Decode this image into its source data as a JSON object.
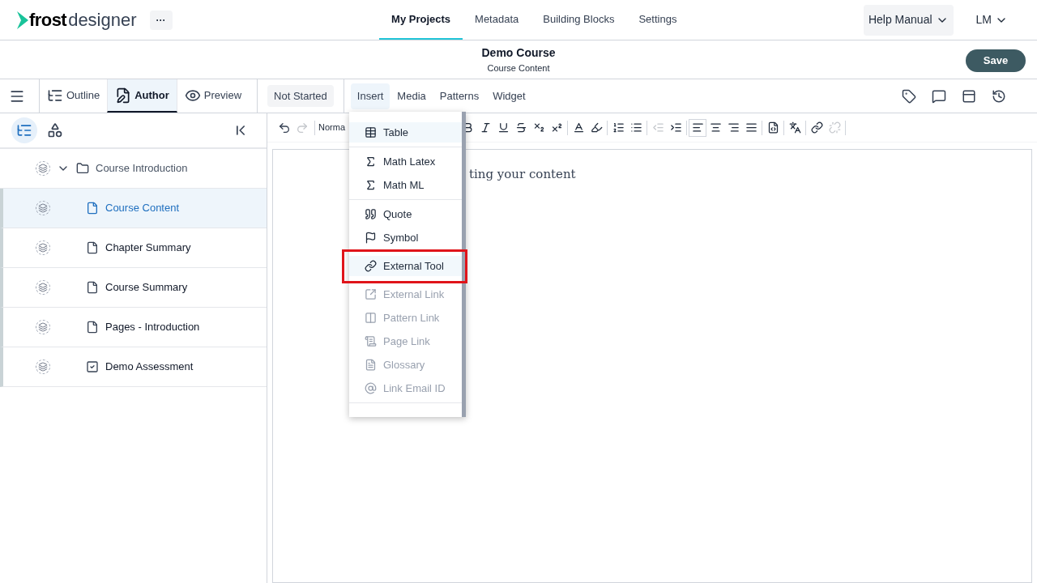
{
  "logo": {
    "part_1": "frost",
    "part_2": "designer"
  },
  "more_button": "···",
  "nav": [
    {
      "label": "My Projects",
      "selected": true
    },
    {
      "label": "Metadata",
      "selected": false
    },
    {
      "label": "Building Blocks",
      "selected": false
    },
    {
      "label": "Settings",
      "selected": false
    }
  ],
  "help_menu": "Help Manual",
  "user_menu": "LM",
  "header": {
    "title": "Demo Course",
    "subtitle": "Course Content",
    "save": "Save"
  },
  "modes": [
    {
      "kind": "outline",
      "label": "Outline",
      "selected": false
    },
    {
      "kind": "author",
      "label": "Author",
      "selected": true
    },
    {
      "kind": "preview",
      "label": "Preview",
      "selected": false
    }
  ],
  "status": "Not Started",
  "insert_tabs": [
    {
      "label": "Insert",
      "selected": true
    },
    {
      "label": "Media",
      "selected": false
    },
    {
      "label": "Patterns",
      "selected": false
    },
    {
      "label": "Widget",
      "selected": false
    }
  ],
  "right_tools": [
    {
      "kind": "tag"
    },
    {
      "kind": "comment"
    },
    {
      "kind": "panel"
    },
    {
      "kind": "history"
    }
  ],
  "sidebar": {
    "views": [
      {
        "kind": "tree",
        "selected": true
      },
      {
        "kind": "blocks",
        "selected": false
      }
    ],
    "items": [
      {
        "kind": "folder",
        "label": "Course Introduction",
        "expanded": true,
        "children": [
          {
            "kind": "page",
            "label": "Course Content",
            "selected": true
          },
          {
            "kind": "page",
            "label": "Chapter Summary",
            "selected": false
          },
          {
            "kind": "page",
            "label": "Course Summary",
            "selected": false
          },
          {
            "kind": "page",
            "label": "Pages - Introduction",
            "selected": false
          },
          {
            "kind": "assessment",
            "label": "Demo Assessment",
            "selected": false
          }
        ]
      }
    ]
  },
  "format_toolbar": {
    "style_value": "Norma",
    "left_tools": [
      {
        "kind": "undo",
        "disabled": false
      },
      {
        "kind": "redo",
        "disabled": true
      }
    ],
    "tools": [
      {
        "kind": "bold",
        "disabled": false,
        "selected": false
      },
      {
        "kind": "italic",
        "disabled": false,
        "selected": false
      },
      {
        "kind": "underline",
        "disabled": false,
        "selected": false
      },
      {
        "kind": "strike",
        "disabled": false,
        "selected": false
      },
      {
        "kind": "subscript",
        "disabled": false,
        "selected": false
      },
      {
        "kind": "superscript",
        "disabled": false,
        "selected": false
      },
      {
        "kind": "sep"
      },
      {
        "kind": "text-color",
        "disabled": false,
        "selected": false
      },
      {
        "kind": "highlight",
        "disabled": false,
        "selected": false
      },
      {
        "kind": "sep"
      },
      {
        "kind": "ordered-list",
        "disabled": false,
        "selected": false
      },
      {
        "kind": "bullet-list",
        "disabled": false,
        "selected": false
      },
      {
        "kind": "sep"
      },
      {
        "kind": "outdent",
        "disabled": true,
        "selected": false
      },
      {
        "kind": "indent",
        "disabled": false,
        "selected": false
      },
      {
        "kind": "sep"
      },
      {
        "kind": "align-left",
        "disabled": false,
        "selected": true
      },
      {
        "kind": "align-center",
        "disabled": false,
        "selected": false
      },
      {
        "kind": "align-right",
        "disabled": false,
        "selected": false
      },
      {
        "kind": "align-justify",
        "disabled": false,
        "selected": false
      },
      {
        "kind": "sep"
      },
      {
        "kind": "source",
        "disabled": false,
        "selected": false
      },
      {
        "kind": "sep"
      },
      {
        "kind": "translate",
        "disabled": false,
        "selected": false
      },
      {
        "kind": "sep"
      },
      {
        "kind": "link",
        "disabled": false,
        "selected": false
      },
      {
        "kind": "unlink",
        "disabled": true,
        "selected": false
      },
      {
        "kind": "sep"
      }
    ]
  },
  "editor_text": "ting your content",
  "insert_menu": [
    {
      "kind": "table",
      "label": "Table",
      "disabled": false,
      "highlighted": true,
      "callout": false,
      "divider_after": true
    },
    {
      "kind": "sigma",
      "label": "Math Latex",
      "disabled": false,
      "highlighted": false,
      "callout": false,
      "divider_after": false
    },
    {
      "kind": "sigma",
      "label": "Math ML",
      "disabled": false,
      "highlighted": false,
      "callout": false,
      "divider_after": true
    },
    {
      "kind": "quote",
      "label": "Quote",
      "disabled": false,
      "highlighted": false,
      "callout": false,
      "divider_after": false
    },
    {
      "kind": "flag",
      "label": "Symbol",
      "disabled": false,
      "highlighted": false,
      "callout": false,
      "divider_after": false
    },
    {
      "kind": "link",
      "label": "External Tool",
      "disabled": false,
      "highlighted": true,
      "callout": true,
      "divider_after": false
    },
    {
      "kind": "external",
      "label": "External Link",
      "disabled": true,
      "highlighted": false,
      "callout": false,
      "divider_after": false
    },
    {
      "kind": "pattern",
      "label": "Pattern Link",
      "disabled": true,
      "highlighted": false,
      "callout": false,
      "divider_after": false
    },
    {
      "kind": "page",
      "label": "Page Link",
      "disabled": true,
      "highlighted": false,
      "callout": false,
      "divider_after": false
    },
    {
      "kind": "glossary",
      "label": "Glossary",
      "disabled": true,
      "highlighted": false,
      "callout": false,
      "divider_after": false
    },
    {
      "kind": "at",
      "label": "Link Email ID",
      "disabled": true,
      "highlighted": false,
      "callout": false,
      "divider_after": true
    }
  ]
}
